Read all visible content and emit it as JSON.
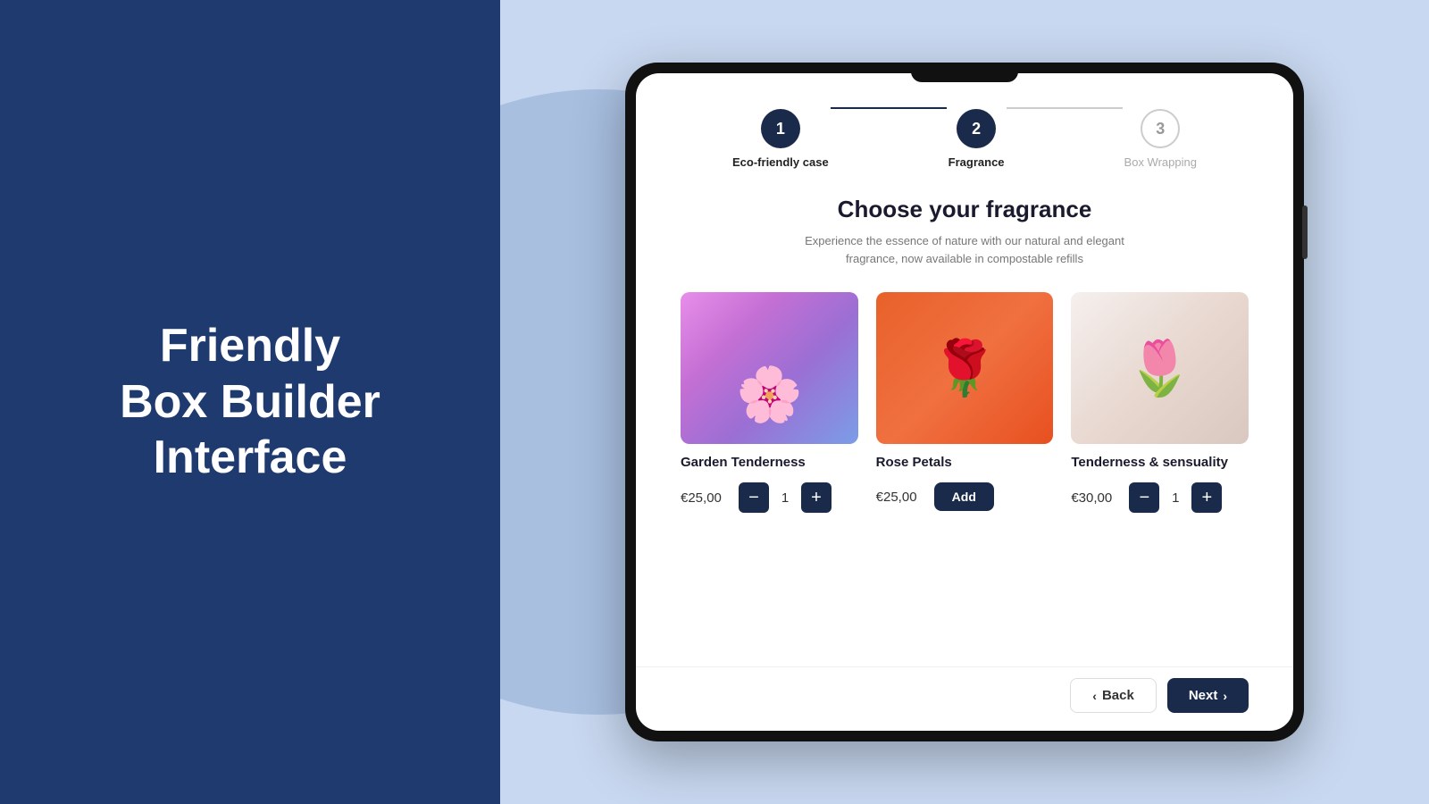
{
  "left": {
    "title_line1": "Friendly",
    "title_line2": "Box Builder",
    "title_line3": "Interface"
  },
  "stepper": {
    "steps": [
      {
        "number": "1",
        "label": "Eco-friendly case",
        "state": "active"
      },
      {
        "number": "2",
        "label": "Fragrance",
        "state": "active"
      },
      {
        "number": "3",
        "label": "Box Wrapping",
        "state": "inactive"
      }
    ],
    "line1_state": "active",
    "line2_state": "inactive"
  },
  "main": {
    "title": "Choose your fragrance",
    "subtitle": "Experience the essence of nature with our natural and elegant\nfragrance, now available in compostable refills"
  },
  "products": [
    {
      "name": "Garden Tenderness",
      "price": "€25,00",
      "quantity": "1",
      "image_type": "garden",
      "has_qty_controls": true,
      "has_add_btn": false
    },
    {
      "name": "Rose Petals",
      "price": "€25,00",
      "quantity": null,
      "image_type": "rose",
      "has_qty_controls": false,
      "has_add_btn": true,
      "add_label": "Add"
    },
    {
      "name": "Tenderness & sensuality",
      "price": "€30,00",
      "quantity": "1",
      "image_type": "tenderness",
      "has_qty_controls": true,
      "has_add_btn": false
    }
  ],
  "navigation": {
    "back_label": "Back",
    "next_label": "Next"
  },
  "icons": {
    "chevron_left": "‹",
    "chevron_right": "›",
    "minus": "−",
    "plus": "+"
  }
}
